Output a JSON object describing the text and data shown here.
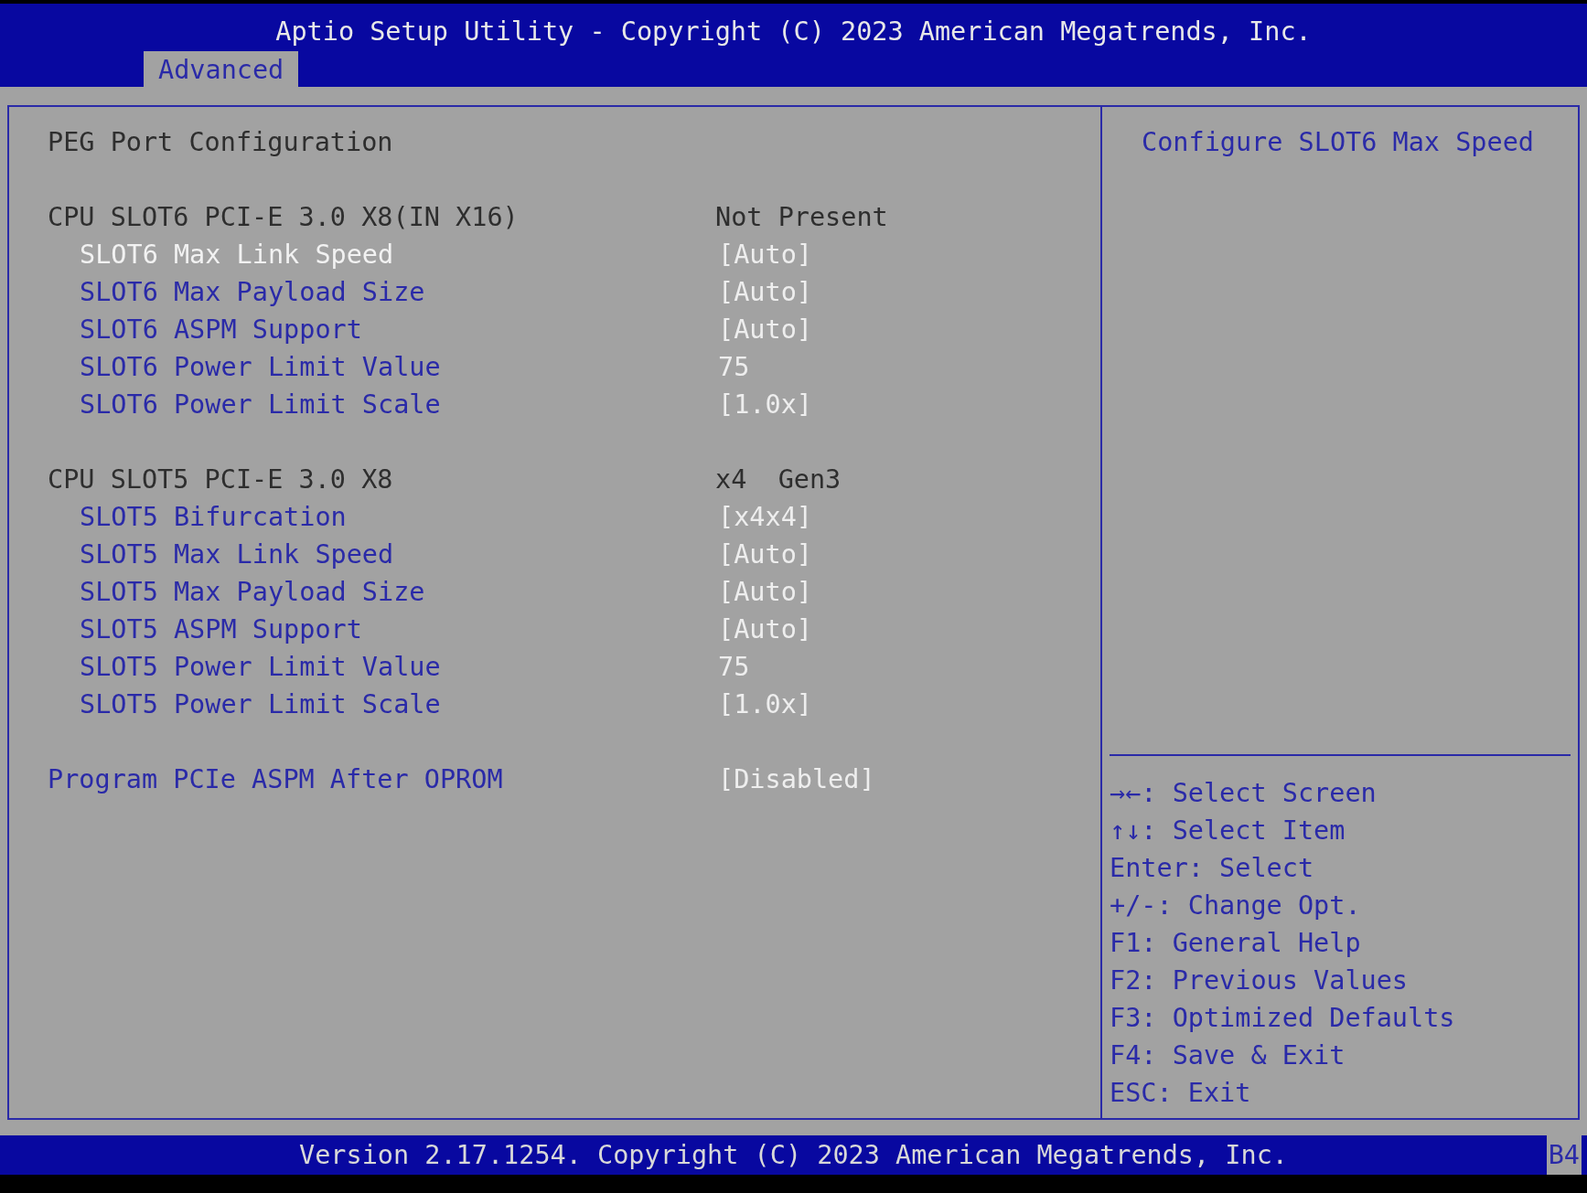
{
  "window": {
    "title": "Aptio Setup Utility - Copyright (C) 2023 American Megatrends, Inc."
  },
  "tabs": [
    {
      "label": "Advanced",
      "selected": true
    }
  ],
  "groups": [
    {
      "rows": [
        {
          "kind": "title",
          "label": "PEG Port Configuration"
        }
      ]
    },
    {
      "rows": [
        {
          "kind": "info",
          "label": "CPU SLOT6 PCI-E 3.0 X8(IN X16)",
          "value": "Not Present"
        },
        {
          "kind": "option",
          "label": "SLOT6 Max Link Speed",
          "value": "[Auto]",
          "selected": true
        },
        {
          "kind": "option",
          "label": "SLOT6 Max Payload Size",
          "value": "[Auto]",
          "selected": false
        },
        {
          "kind": "option",
          "label": "SLOT6 ASPM Support",
          "value": "[Auto]",
          "selected": false
        },
        {
          "kind": "option",
          "label": "SLOT6 Power Limit Value",
          "value": "75",
          "selected": false
        },
        {
          "kind": "option",
          "label": "SLOT6 Power Limit Scale",
          "value": "[1.0x]",
          "selected": false
        }
      ]
    },
    {
      "rows": [
        {
          "kind": "info",
          "label": "CPU SLOT5 PCI-E 3.0 X8",
          "value": "x4  Gen3"
        },
        {
          "kind": "option",
          "label": "SLOT5 Bifurcation",
          "value": "[x4x4]",
          "selected": false
        },
        {
          "kind": "option",
          "label": "SLOT5 Max Link Speed",
          "value": "[Auto]",
          "selected": false
        },
        {
          "kind": "option",
          "label": "SLOT5 Max Payload Size",
          "value": "[Auto]",
          "selected": false
        },
        {
          "kind": "option",
          "label": "SLOT5 ASPM Support",
          "value": "[Auto]",
          "selected": false
        },
        {
          "kind": "option",
          "label": "SLOT5 Power Limit Value",
          "value": "75",
          "selected": false
        },
        {
          "kind": "option",
          "label": "SLOT5 Power Limit Scale",
          "value": "[1.0x]",
          "selected": false
        }
      ]
    },
    {
      "rows": [
        {
          "kind": "toplevel",
          "label": "Program PCIe ASPM After OPROM",
          "value": "[Disabled]",
          "selected": false
        }
      ]
    }
  ],
  "help": {
    "text": "Configure SLOT6 Max Speed"
  },
  "key_help": [
    "→←: Select Screen",
    "↑↓: Select Item",
    "Enter: Select",
    "+/-: Change Opt.",
    "F1: General Help",
    "F2: Previous Values",
    "F3: Optimized Defaults",
    "F4: Save & Exit",
    "ESC: Exit"
  ],
  "status_bar": {
    "text": "Version 2.17.1254. Copyright (C) 2023 American Megatrends, Inc.",
    "code": "B4"
  }
}
